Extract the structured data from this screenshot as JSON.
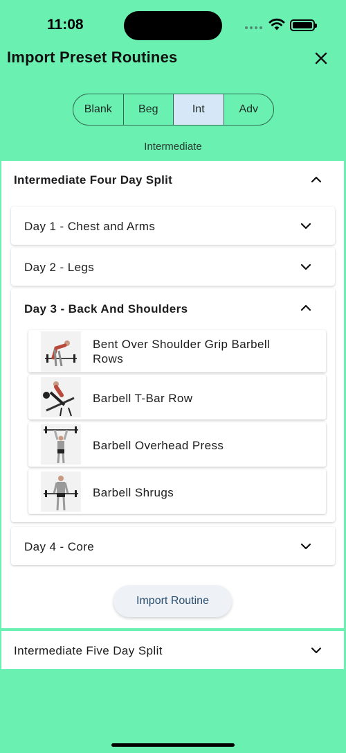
{
  "status_bar": {
    "time": "11:08"
  },
  "header": {
    "title": "Import Preset Routines"
  },
  "level_tabs": [
    {
      "label": "Blank",
      "active": false
    },
    {
      "label": "Beg",
      "active": false
    },
    {
      "label": "Int",
      "active": true
    },
    {
      "label": "Adv",
      "active": false
    }
  ],
  "level_label": "Intermediate",
  "routines": [
    {
      "title": "Intermediate Four Day Split",
      "expanded": true,
      "days": [
        {
          "label": "Day 1 - Chest and Arms",
          "expanded": false
        },
        {
          "label": "Day 2 - Legs",
          "expanded": false
        },
        {
          "label": "Day 3 - Back And Shoulders",
          "expanded": true,
          "exercises": [
            {
              "name": "Bent Over Shoulder Grip Barbell Rows"
            },
            {
              "name": "Barbell T-Bar Row"
            },
            {
              "name": "Barbell Overhead Press"
            },
            {
              "name": "Barbell Shrugs"
            }
          ]
        },
        {
          "label": "Day 4 - Core",
          "expanded": false
        }
      ],
      "import_label": "Import Routine"
    },
    {
      "title": "Intermediate Five Day Split",
      "expanded": false
    }
  ],
  "colors": {
    "background": "#6af0b0",
    "active_tab": "#d6e8f7",
    "button_text": "#2a4e6e"
  },
  "icons": {
    "close": "close-icon",
    "expand": "chevron-down-icon",
    "collapse": "chevron-up-icon"
  }
}
